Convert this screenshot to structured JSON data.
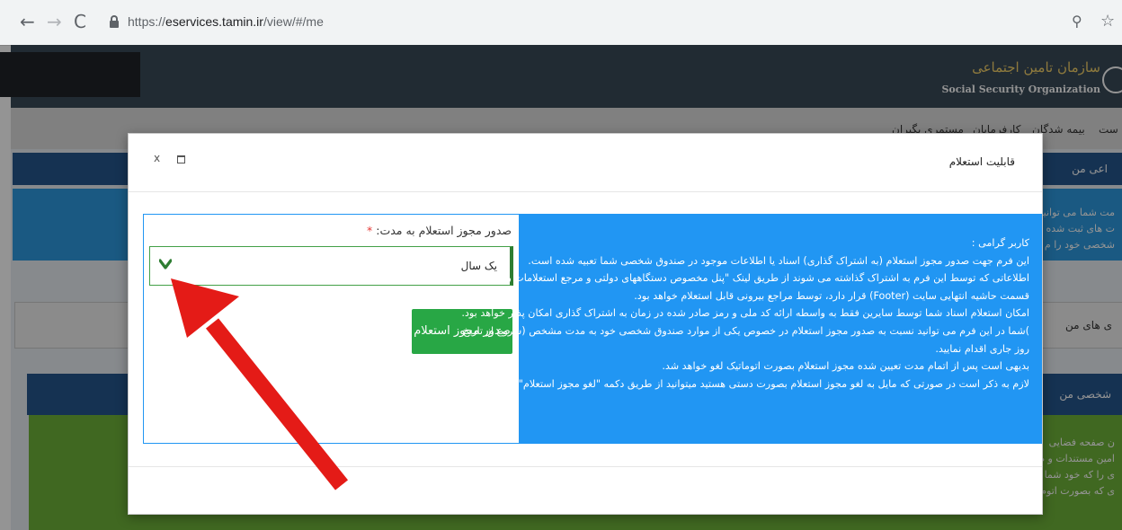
{
  "browser": {
    "url_prefix": "https://",
    "url_host": "eservices.tamin.ir",
    "url_path": "/view/#/me",
    "back_icon": "arrow-left-icon",
    "forward_icon": "arrow-right-icon",
    "reload_icon": "reload-icon",
    "lock_icon": "lock-icon",
    "zoom_icon": "zoom-icon",
    "star_icon": "star-icon"
  },
  "site": {
    "org_name_fa": "سازمان تامین اجتماعی",
    "org_name_en": "Social Security Organization",
    "nav": [
      "بیمه شدگان",
      "کارفرمایان",
      "مستمری بگیران"
    ],
    "nav_partial": "ست"
  },
  "background": {
    "panel_head_1": "اعی من",
    "info_lines": [
      "مت شما می توانید",
      "ت های ثبت شده",
      "شخصی خود را م"
    ],
    "tab_label": "ی های من",
    "panel_head_2": "شخصی من",
    "green_lines": [
      "ن صفحه فضایی",
      "امین مستندات و م",
      "ی را که خود شما",
      "ی که بصورت اتوم"
    ]
  },
  "modal": {
    "title": "قابلیت استعلام",
    "close_label": "x",
    "info": {
      "lines": [
        "کاربر گرامی :",
        "این فرم جهت صدور مجوز استعلام (به اشتراک گذاری) اسناد یا اطلاعات موجود در صندوق شخصی شما تعبیه شده است.",
        "اطلاعاتی که توسط این فرم به اشتراک گذاشته می شوند از طریق لینک \"پنل مخصوص دستگاههای دولتی و مرجع استعلامات رسمی\" که در",
        "قسمت حاشیه انتهایی سایت (Footer) قرار دارد، توسط مراجع بیرونی قابل استعلام خواهد بود.",
        "امکان استعلام اسناد شما توسط سایرین فقط به واسطه ارائه کد ملی و رمز صادر شده در زمان به اشتراک گذاری امکان پذیر خواهد بود.",
        ")شما در این فرم می توانید نسبت به صدور مجوز استعلام در خصوص یکی از موارد صندوق شخصی خود به مدت مشخص (شروع از تاریخ",
        "روز جاری اقدام نمایید.",
        "بدیهی است پس از اتمام مدت تعیین شده مجوز استعلام بصورت اتوماتیک لغو خواهد شد.",
        "لازم به ذکر است در صورتی که مایل به لغو مجوز استعلام بصورت دستی هستید میتوانید از طریق دکمه \"لغو مجوز استعلام\" اقدام نمایید."
      ]
    },
    "form": {
      "label": "صدور مجوز استعلام به مدت:",
      "required_mark": "*",
      "selected_value": "یک سال",
      "submit_label": "صدور مجوز استعلام"
    }
  },
  "colors": {
    "info_bg": "#2196f3",
    "submit_bg": "#28a745",
    "arrow": "#e41b17",
    "header_bg": "#3a4a58"
  }
}
